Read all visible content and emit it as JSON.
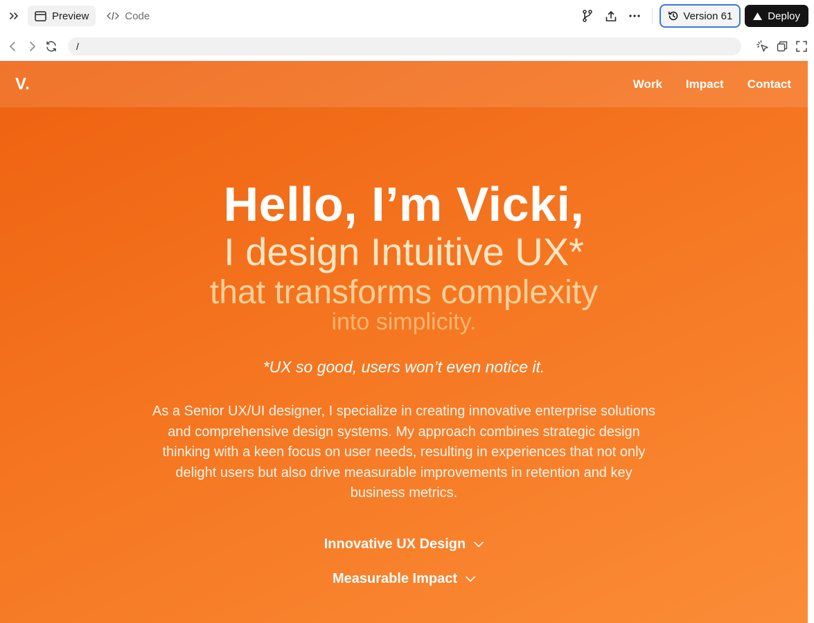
{
  "toolbar": {
    "tabs": [
      {
        "label": "Preview",
        "active": true
      },
      {
        "label": "Code",
        "active": false
      }
    ],
    "version_label": "Version 61",
    "deploy_label": "Deploy"
  },
  "address_bar": {
    "url": "/"
  },
  "site": {
    "logo": "V.",
    "nav": [
      "Work",
      "Impact",
      "Contact"
    ],
    "hero": {
      "line1": "Hello, I’m Vicki,",
      "line2": "I design Intuitive UX*",
      "line3": "that transforms complexity",
      "line4": "into simplicity.",
      "tagline": "*UX so good, users won’t even notice it.",
      "description": "As a Senior UX/UI designer, I specialize in creating innovative enterprise solutions and comprehensive design systems. My approach combines strategic design thinking with a keen focus on user needs, resulting in experiences that not only delight users but also drive measurable improvements in retention and key business metrics."
    },
    "accordion": [
      "Innovative UX Design",
      "Measurable Impact"
    ]
  },
  "colors": {
    "accent_orange": "#f57520",
    "version_border": "#3a78d8",
    "deploy_bg": "#141414"
  },
  "icons": {
    "collapse": "double-chevron-right-icon",
    "preview": "browser-window-icon",
    "code": "code-brackets-icon",
    "branch": "git-branch-icon",
    "share": "upload-icon",
    "more": "ellipsis-icon",
    "history": "history-icon",
    "deploy": "triangle-icon",
    "back": "chevron-left-icon",
    "forward": "chevron-right-icon",
    "reload": "refresh-icon",
    "select": "cursor-click-icon",
    "new_window": "new-window-icon",
    "fullscreen": "fullscreen-icon",
    "accordion": "chevron-down-icon"
  }
}
